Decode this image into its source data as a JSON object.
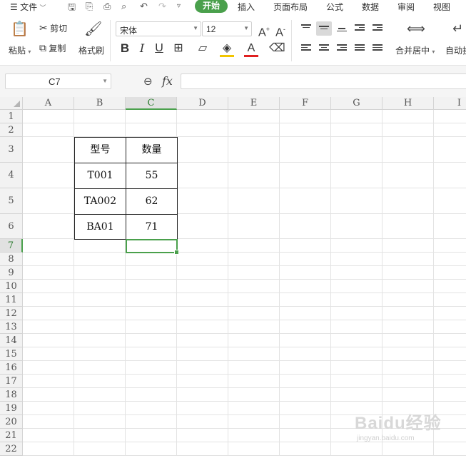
{
  "menu": {
    "file_label": "文件",
    "tabs": [
      "开始",
      "插入",
      "页面布局",
      "公式",
      "数据",
      "审阅",
      "视图"
    ],
    "active_tab": "开始"
  },
  "ribbon": {
    "paste_label": "粘贴",
    "cut_label": "剪切",
    "copy_label": "复制",
    "format_painter_label": "格式刷",
    "font_name": "宋体",
    "font_size": "12",
    "merge_center_label": "合并居中",
    "wrap_text_label": "自动换"
  },
  "formula_bar": {
    "name_box": "C7",
    "fx_label": "fx",
    "formula_value": ""
  },
  "grid": {
    "columns": [
      "A",
      "B",
      "C",
      "D",
      "E",
      "F",
      "G",
      "H",
      "I"
    ],
    "rows": [
      "1",
      "2",
      "3",
      "4",
      "5",
      "6",
      "7",
      "8",
      "9",
      "10",
      "11",
      "12",
      "13",
      "14",
      "15",
      "16",
      "17",
      "18",
      "19",
      "20",
      "21",
      "22"
    ],
    "selected_column": "C",
    "selected_row": "7",
    "table": {
      "headers": [
        "型号",
        "数量"
      ],
      "rows": [
        [
          "T001",
          "55"
        ],
        [
          "TA002",
          "62"
        ],
        [
          "BA01",
          "71"
        ]
      ]
    }
  },
  "watermark": {
    "brand": "Baidu经验",
    "url": "jingyan.baidu.com"
  },
  "colors": {
    "accent": "#4aa04c",
    "header_bg": "#f2f2f2",
    "gridline": "#e3e3e3"
  }
}
